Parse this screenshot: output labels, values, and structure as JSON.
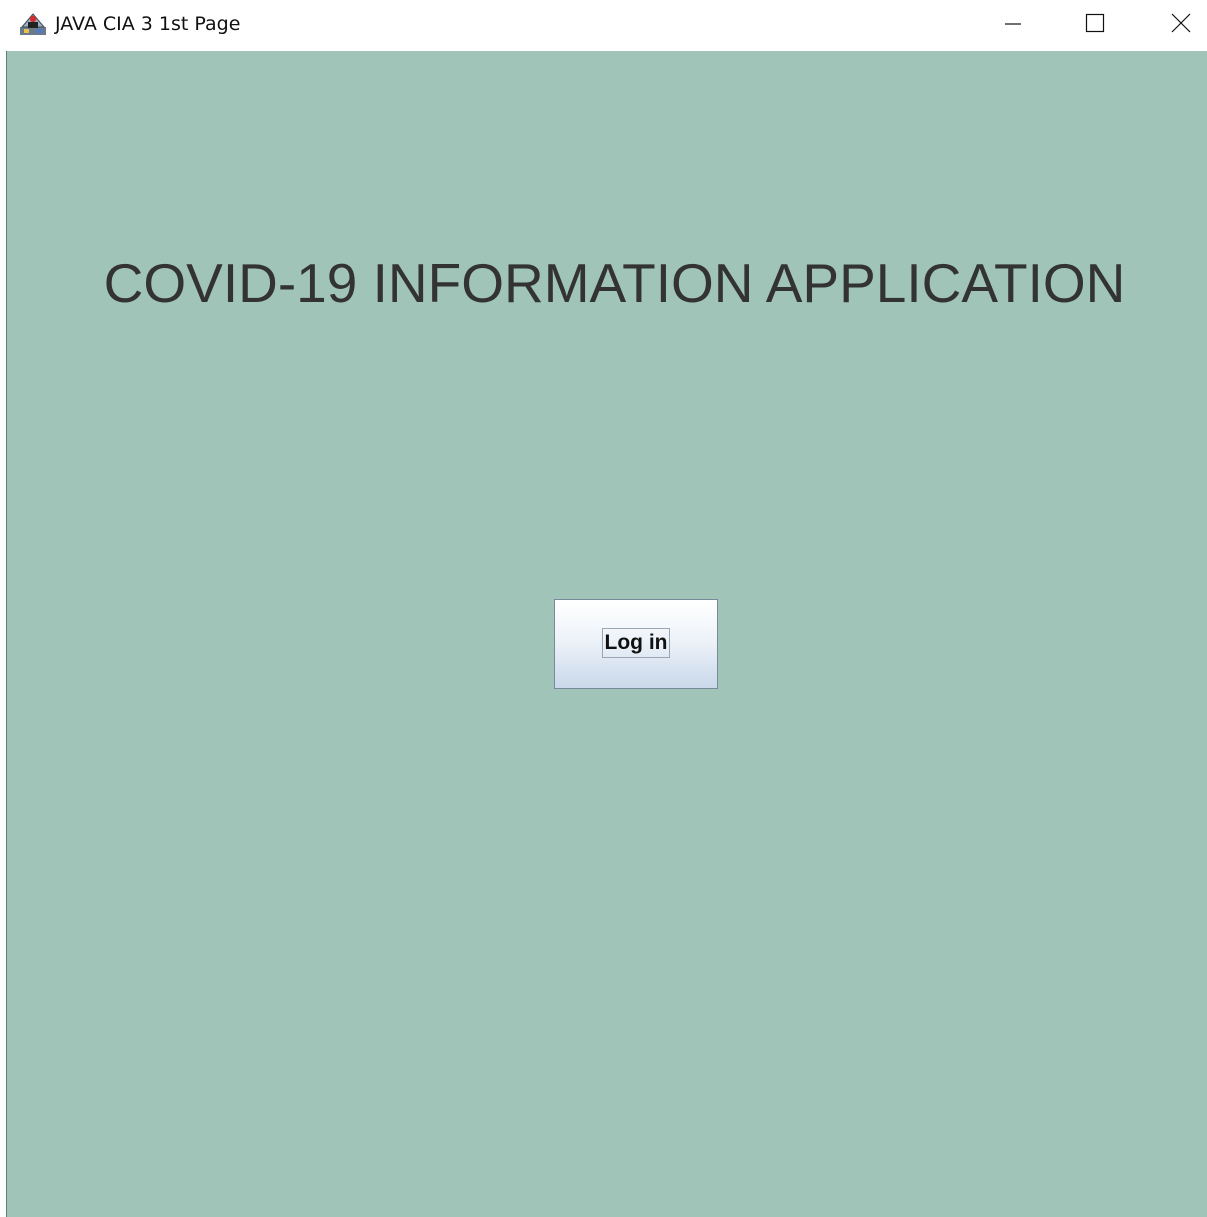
{
  "window": {
    "title": "JAVA CIA 3 1st Page",
    "icon": "java-duke-icon",
    "controls": {
      "minimize_icon": "minimize-icon",
      "maximize_icon": "maximize-icon",
      "close_icon": "close-icon"
    }
  },
  "main": {
    "heading": "COVID-19 INFORMATION APPLICATION",
    "login_button_label": "Log in",
    "background_color": "#a1c4b9"
  }
}
